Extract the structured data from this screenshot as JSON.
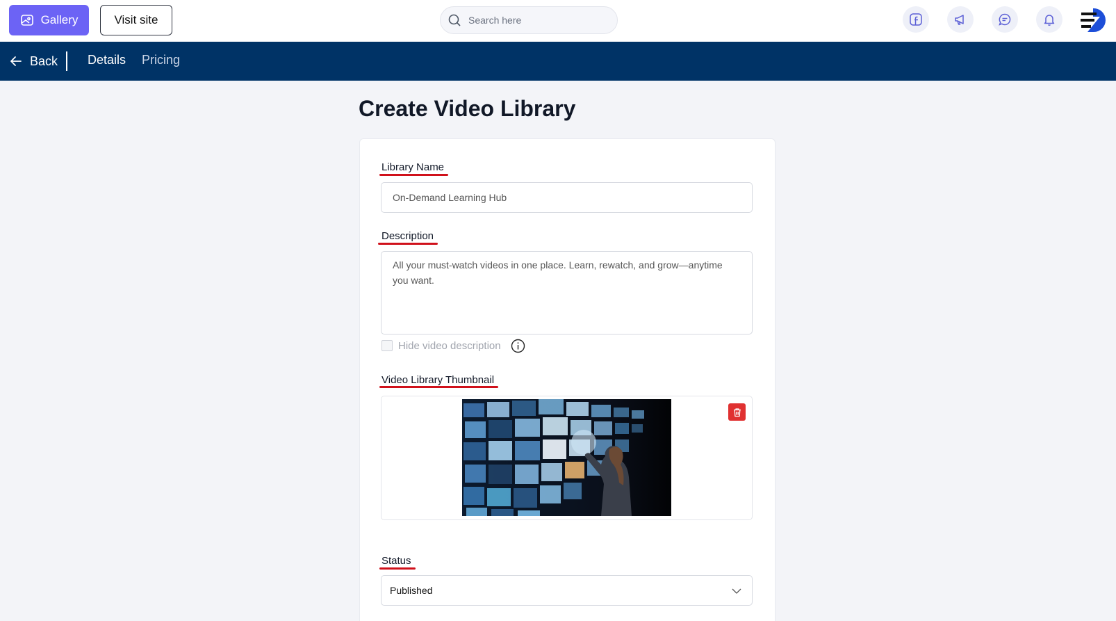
{
  "topbar": {
    "gallery_label": "Gallery",
    "visit_label": "Visit site",
    "search_placeholder": "Search here",
    "icons": [
      "facebook-icon",
      "megaphone-icon",
      "chat-icon",
      "bell-icon",
      "avatar-logo"
    ]
  },
  "navbar": {
    "back_label": "Back",
    "tabs": [
      {
        "label": "Details",
        "active": true
      },
      {
        "label": "Pricing",
        "active": false
      }
    ]
  },
  "page": {
    "title": "Create Video Library"
  },
  "form": {
    "library_name_label": "Library Name",
    "library_name_value": "On-Demand Learning Hub",
    "description_label": "Description",
    "description_value": "All your must-watch videos in one place. Learn, rewatch, and grow—anytime you want.",
    "hide_description_label": "Hide video description",
    "hide_description_checked": false,
    "thumbnail_label": "Video Library Thumbnail",
    "status_label": "Status",
    "status_value": "Published"
  },
  "colors": {
    "primary": "#6c63f5",
    "navbar": "#003366",
    "annotation_underline": "#d0111b",
    "delete": "#e03131"
  }
}
